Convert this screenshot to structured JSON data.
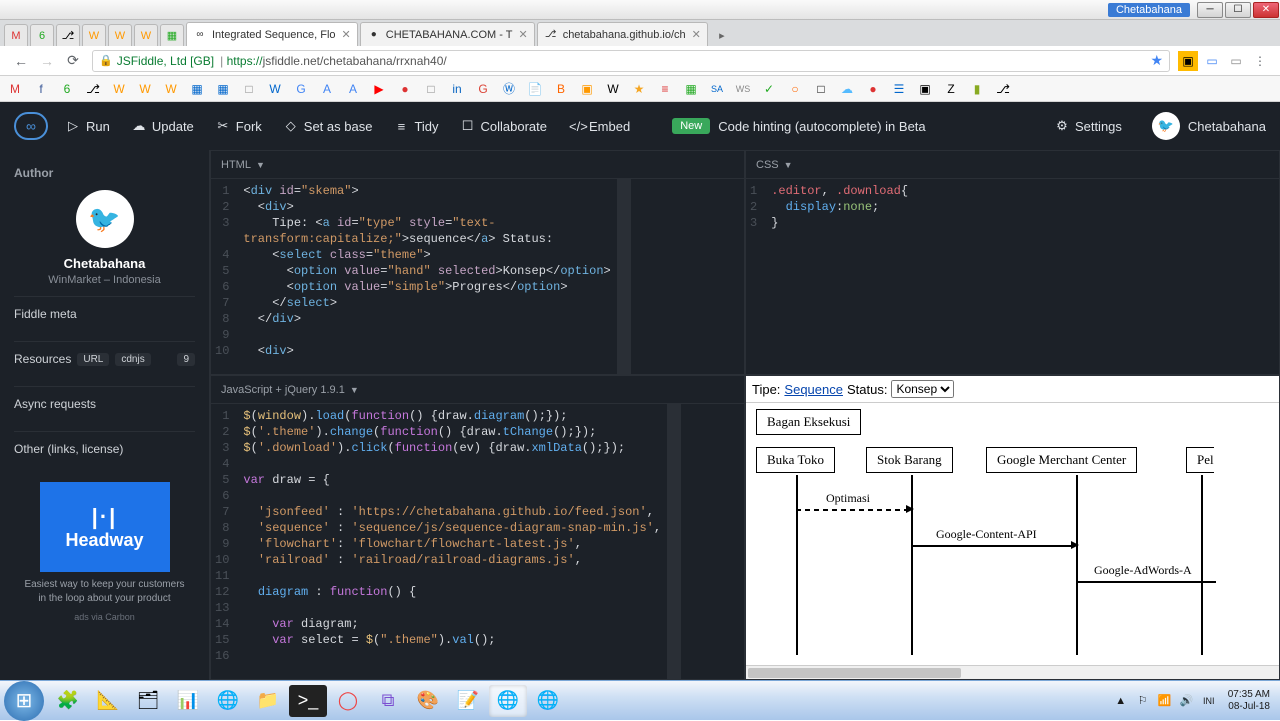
{
  "window": {
    "profile": "Chetabahana"
  },
  "tabs": [
    {
      "icon": "M",
      "color": "#d33"
    },
    {
      "icon": "6",
      "color": "#2a2"
    },
    {
      "icon": "⎇",
      "color": "#222"
    },
    {
      "icon": "W",
      "color": "#f90"
    },
    {
      "icon": "W",
      "color": "#f90"
    },
    {
      "icon": "W",
      "color": "#f90"
    },
    {
      "icon": "▦",
      "color": "#2a2"
    }
  ],
  "page_tabs": [
    {
      "label": "Integrated Sequence, Flo",
      "active": true,
      "icon": "∞"
    },
    {
      "label": "CHETABAHANA.COM - T",
      "active": false,
      "icon": "●"
    },
    {
      "label": "chetabahana.github.io/ch",
      "active": false,
      "icon": "⎇"
    }
  ],
  "addr": {
    "cert": "JSFiddle, Ltd [GB]",
    "proto": "https://",
    "rest": "jsfiddle.net/chetabahana/rrxnah40/"
  },
  "bookmarks": [
    "M",
    "f",
    "6",
    "⎇",
    "W",
    "W",
    "W",
    "▦",
    "▦",
    "□",
    "W",
    "G",
    "A",
    "A",
    "▶",
    "●",
    "□",
    "in",
    "G",
    "W",
    "📄",
    "B",
    "▣",
    "W",
    "★",
    "≡",
    "▦",
    "SA",
    "WS",
    "✓",
    "○",
    "□",
    "☁",
    "●",
    "☰",
    "▣",
    "Z",
    "▮",
    "⎇"
  ],
  "jf": {
    "run": "Run",
    "update": "Update",
    "fork": "Fork",
    "setbase": "Set as base",
    "tidy": "Tidy",
    "collab": "Collaborate",
    "embed": "Embed",
    "new": "New",
    "hint": "Code hinting (autocomplete) in Beta",
    "settings": "Settings",
    "user": "Chetabahana"
  },
  "side": {
    "author_hdr": "Author",
    "author": "Chetabahana",
    "author_sub": "WinMarket – Indonesia",
    "meta": "Fiddle meta",
    "resources": "Resources",
    "url": "URL",
    "cdnjs": "cdnjs",
    "res_count": "9",
    "async": "Async requests",
    "other": "Other (links, license)",
    "ad_name": "Headway",
    "ad_txt": "Easiest way to keep your customers in the loop about your product",
    "ad_link": "ads via Carbon"
  },
  "panes": {
    "html": "HTML",
    "css": "CSS",
    "js": "JavaScript + jQuery 1.9.1"
  },
  "code_html_gutter": [
    "1",
    "2",
    "3",
    "4",
    "5",
    "6",
    "7",
    "8",
    "9",
    "10"
  ],
  "code_css_gutter": [
    "1",
    "2",
    "3"
  ],
  "code_js_gutter": [
    "1",
    "2",
    "3",
    "4",
    "5",
    "6",
    "7",
    "8",
    "9",
    "10",
    "11",
    "12",
    "13",
    "14",
    "15",
    "16"
  ],
  "result": {
    "tipe": "Tipe:",
    "seq": "Sequence",
    "status": "Status:",
    "option": "Konsep",
    "bagan": "Bagan Eksekusi",
    "p1": "Buka Toko",
    "p2": "Stok Barang",
    "p3": "Google Merchant Center",
    "p4": "Pel",
    "m1": "Optimasi",
    "m2": "Google-Content-API",
    "m3": "Google-AdWords-A"
  },
  "clock": {
    "time": "07:35 AM",
    "date": "08-Jul-18"
  },
  "tray_lang": "INI"
}
